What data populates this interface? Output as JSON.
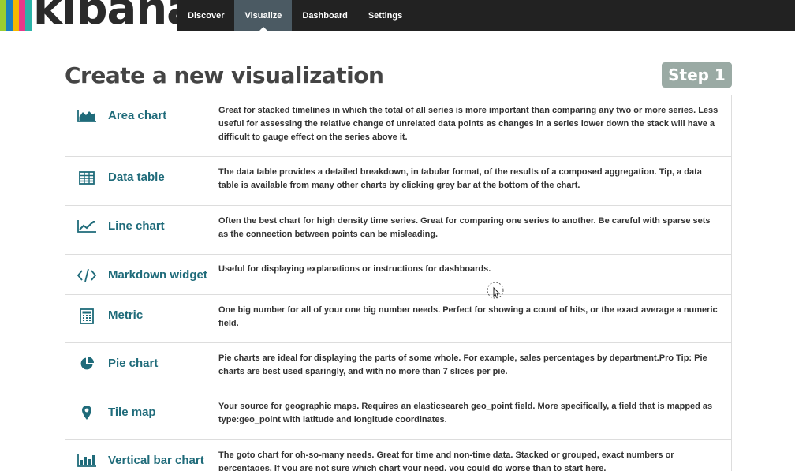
{
  "nav": {
    "logo_text": "kibana",
    "stripe_colors": [
      "#9acd32",
      "#1a7fc1",
      "#f5b800",
      "#e8388a",
      "#2bb3a8"
    ],
    "items": [
      {
        "label": "Discover",
        "active": false
      },
      {
        "label": "Visualize",
        "active": true
      },
      {
        "label": "Dashboard",
        "active": false
      },
      {
        "label": "Settings",
        "active": false
      }
    ]
  },
  "header": {
    "title": "Create a new visualization",
    "step": "Step 1"
  },
  "colors": {
    "accent": "#1f6b7a",
    "nav_bg": "#222222",
    "active_nav": "#4b5a63",
    "step_badge": "#9aaaa4"
  },
  "visualizations": [
    {
      "icon": "area-chart-icon",
      "name": "Area chart",
      "description": "Great for stacked timelines in which the total of all series is more important than comparing any two or more series. Less useful for assessing the relative change of unrelated data points as changes in a series lower down the stack will have a difficult to gauge effect on the series above it."
    },
    {
      "icon": "table-icon",
      "name": "Data table",
      "description": "The data table provides a detailed breakdown, in tabular format, of the results of a composed aggregation. Tip, a data table is available from many other charts by clicking grey bar at the bottom of the chart."
    },
    {
      "icon": "line-chart-icon",
      "name": "Line chart",
      "description": "Often the best chart for high density time series. Great for comparing one series to another. Be careful with sparse sets as the connection between points can be misleading."
    },
    {
      "icon": "code-icon",
      "name": "Markdown widget",
      "description": "Useful for displaying explanations or instructions for dashboards."
    },
    {
      "icon": "calculator-icon",
      "name": "Metric",
      "description": "One big number for all of your one big number needs. Perfect for showing a count of hits, or the exact average a numeric field."
    },
    {
      "icon": "pie-chart-icon",
      "name": "Pie chart",
      "description": "Pie charts are ideal for displaying the parts of some whole. For example, sales percentages by department.Pro Tip: Pie charts are best used sparingly, and with no more than 7 slices per pie."
    },
    {
      "icon": "map-marker-icon",
      "name": "Tile map",
      "description": "Your source for geographic maps. Requires an elasticsearch geo_point field. More specifically, a field that is mapped as type:geo_point with latitude and longitude coordinates."
    },
    {
      "icon": "bar-chart-icon",
      "name": "Vertical bar chart",
      "description": "The goto chart for oh-so-many needs. Great for time and non-time data. Stacked or grouped, exact numbers or percentages. If you are not sure which chart your need, you could do worse than to start here."
    }
  ]
}
